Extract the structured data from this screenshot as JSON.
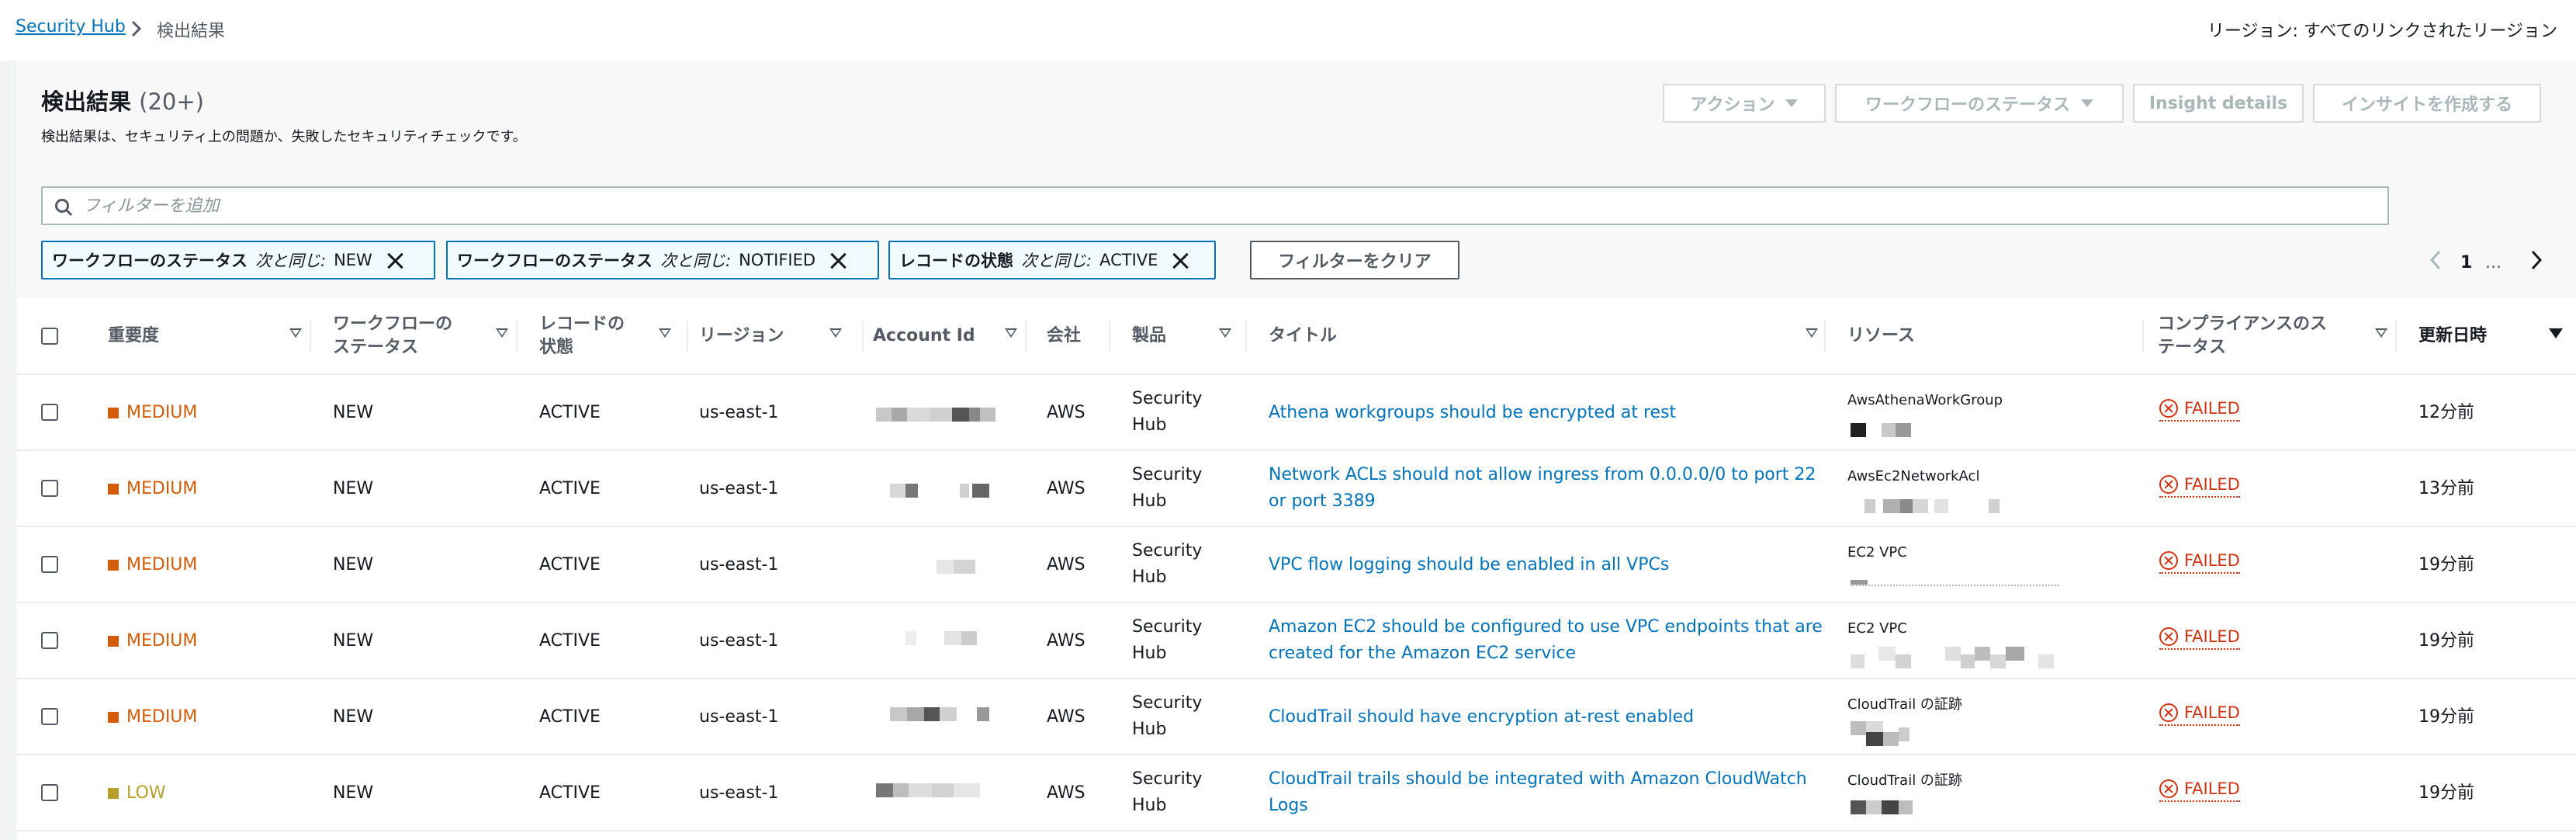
{
  "breadcrumb": {
    "root": "Security Hub",
    "current": "検出結果"
  },
  "region": "リージョン: すべてのリンクされたリージョン",
  "header": {
    "title": "検出結果",
    "count": "(20+)",
    "description": "検出結果は、セキュリティ上の問題か、失敗したセキュリティチェックです。"
  },
  "actions": {
    "action_label": "アクション",
    "workflow_label": "ワークフローのステータス",
    "insight_details_label": "Insight details",
    "create_insight_label": "インサイトを作成する"
  },
  "search": {
    "placeholder": "フィルターを追加"
  },
  "filters": [
    {
      "key": "ワークフローのステータス",
      "op": "次と同じ:",
      "value": "NEW"
    },
    {
      "key": "ワークフローのステータス",
      "op": "次と同じ:",
      "value": "NOTIFIED"
    },
    {
      "key": "レコードの状態",
      "op": "次と同じ:",
      "value": "ACTIVE"
    }
  ],
  "clear_filters_label": "フィルターをクリア",
  "pagination": {
    "current": "1",
    "ellipsis": "..."
  },
  "columns": {
    "severity": "重要度",
    "workflow_line1": "ワークフローの",
    "workflow_line2": "ステータス",
    "record_line1": "レコードの",
    "record_line2": "状態",
    "region": "リージョン",
    "account": "Account Id",
    "company": "会社",
    "product": "製品",
    "title": "タイトル",
    "resource": "リソース",
    "compliance_line1": "コンプライアンスのス",
    "compliance_line2": "テータス",
    "updated": "更新日時"
  },
  "rows": [
    {
      "severity": "MEDIUM",
      "workflow": "NEW",
      "record": "ACTIVE",
      "region": "us-east-1",
      "company": "AWS",
      "product_line1": "Security",
      "product_line2": "Hub",
      "title_line1": "Athena workgroups should be encrypted at rest",
      "title_line2": "",
      "resource_type": "AwsAthenaWorkGroup",
      "compliance": "FAILED",
      "updated": "12分前"
    },
    {
      "severity": "MEDIUM",
      "workflow": "NEW",
      "record": "ACTIVE",
      "region": "us-east-1",
      "company": "AWS",
      "product_line1": "Security",
      "product_line2": "Hub",
      "title_line1": "Network ACLs should not allow ingress from 0.0.0.0/0 to port 22",
      "title_line2": "or port 3389",
      "resource_type": "AwsEc2NetworkAcl",
      "compliance": "FAILED",
      "updated": "13分前"
    },
    {
      "severity": "MEDIUM",
      "workflow": "NEW",
      "record": "ACTIVE",
      "region": "us-east-1",
      "company": "AWS",
      "product_line1": "Security",
      "product_line2": "Hub",
      "title_line1": "VPC flow logging should be enabled in all VPCs",
      "title_line2": "",
      "resource_type": "EC2 VPC",
      "compliance": "FAILED",
      "updated": "19分前"
    },
    {
      "severity": "MEDIUM",
      "workflow": "NEW",
      "record": "ACTIVE",
      "region": "us-east-1",
      "company": "AWS",
      "product_line1": "Security",
      "product_line2": "Hub",
      "title_line1": "Amazon EC2 should be configured to use VPC endpoints that are",
      "title_line2": "created for the Amazon EC2 service",
      "resource_type": "EC2 VPC",
      "compliance": "FAILED",
      "updated": "19分前"
    },
    {
      "severity": "MEDIUM",
      "workflow": "NEW",
      "record": "ACTIVE",
      "region": "us-east-1",
      "company": "AWS",
      "product_line1": "Security",
      "product_line2": "Hub",
      "title_line1": "CloudTrail should have encryption at-rest enabled",
      "title_line2": "",
      "resource_type": "CloudTrail の証跡",
      "compliance": "FAILED",
      "updated": "19分前"
    },
    {
      "severity": "LOW",
      "workflow": "NEW",
      "record": "ACTIVE",
      "region": "us-east-1",
      "company": "AWS",
      "product_line1": "Security",
      "product_line2": "Hub",
      "title_line1": "CloudTrail trails should be integrated with Amazon CloudWatch",
      "title_line2": "Logs",
      "resource_type": "CloudTrail の証跡",
      "compliance": "FAILED",
      "updated": "19分前"
    }
  ],
  "colors": {
    "link": "#0073bb",
    "medium": "#d45b07",
    "low": "#b7a02a",
    "failed": "#d13212"
  }
}
